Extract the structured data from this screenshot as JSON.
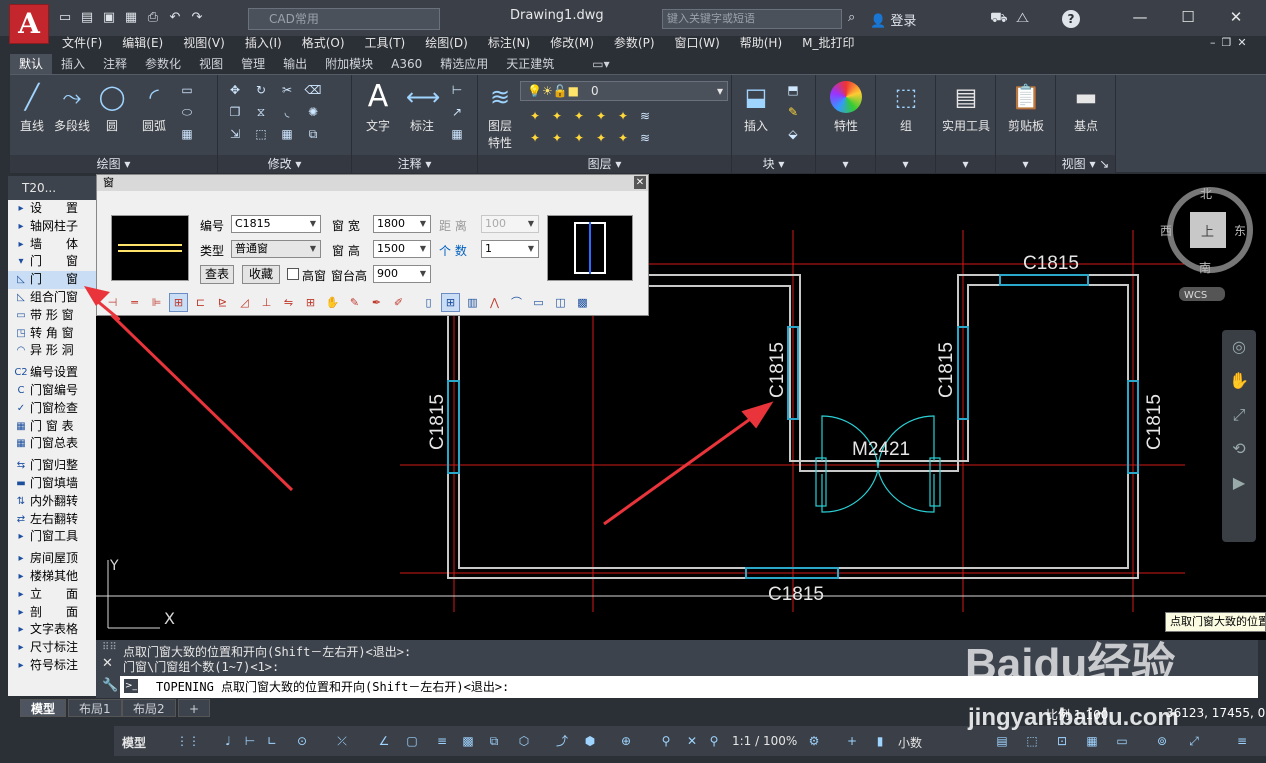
{
  "title_bar": {
    "app_letter": "A",
    "workspace": "CAD常用",
    "document_title": "Drawing1.dwg",
    "search_placeholder": "键入关键字或短语",
    "login_label": "登录"
  },
  "menubar": [
    "文件(F)",
    "编辑(E)",
    "视图(V)",
    "插入(I)",
    "格式(O)",
    "工具(T)",
    "绘图(D)",
    "标注(N)",
    "修改(M)",
    "参数(P)",
    "窗口(W)",
    "帮助(H)",
    "M_批打印"
  ],
  "ribbon_tabs": [
    "默认",
    "插入",
    "注释",
    "参数化",
    "视图",
    "管理",
    "输出",
    "附加模块",
    "A360",
    "精选应用",
    "天正建筑"
  ],
  "ribbon": {
    "draw": {
      "label": "绘图",
      "buttons": [
        "直线",
        "多段线",
        "圆",
        "圆弧"
      ]
    },
    "modify": {
      "label": "修改"
    },
    "annotation": {
      "label": "注释",
      "buttons": [
        "文字",
        "标注"
      ]
    },
    "layers": {
      "label": "图层",
      "button": "图层\n特性",
      "layer_name": "0"
    },
    "block": {
      "label": "块",
      "button": "插入"
    },
    "properties": {
      "button": "特性"
    },
    "group": {
      "button": "组"
    },
    "utilities": {
      "button": "实用工具"
    },
    "clipboard": {
      "button": "剪贴板"
    },
    "base": {
      "button": "基点"
    },
    "view": {
      "label": "视图"
    }
  },
  "palette": {
    "header": "T20...",
    "items": [
      "设　　置",
      "轴网柱子",
      "墙　　体",
      "门　　窗",
      "门　　窗",
      "组合门窗",
      "带 形 窗",
      "转 角 窗",
      "异 形 洞",
      "编号设置",
      "门窗编号",
      "门窗检查",
      "门 窗 表",
      "门窗总表",
      "门窗归整",
      "门窗填墙",
      "内外翻转",
      "左右翻转",
      "门窗工具",
      "房间屋顶",
      "楼梯其他",
      "立　　面",
      "剖　　面",
      "文字表格",
      "尺寸标注",
      "符号标注"
    ]
  },
  "dialog": {
    "title": "窗",
    "number_label": "编号",
    "number_value": "C1815",
    "type_label": "类型",
    "type_value": "普通窗",
    "width_label": "窗 宽",
    "width_value": "1800",
    "height_label": "窗 高",
    "height_value": "1500",
    "sill_label": "窗台高",
    "sill_value": "900",
    "distance_label": "距 离",
    "distance_value": "100",
    "count_label": "个 数",
    "count_value": "1",
    "lookup_button": "查表",
    "favorite_button": "收藏",
    "high_window_label": "高窗"
  },
  "drawing": {
    "labels": {
      "top_right": "C1815",
      "left": "C1815",
      "center_left": "C1815",
      "center_right": "C1815",
      "right": "C1815",
      "bottom": "C1815",
      "door": "M2421"
    },
    "viewcube": {
      "north": "北",
      "south": "南",
      "east": "东",
      "west": "西",
      "center": "上",
      "wcs": "WCS"
    },
    "ucs": {
      "x": "X",
      "y": "Y"
    }
  },
  "command": {
    "history": [
      "点取门窗大致的位置和开向(Shift－左右开)<退出>:",
      "门窗\\门窗组个数(1~7)<1>:"
    ],
    "current": "TOPENING 点取门窗大致的位置和开向(Shift－左右开)<退出>:"
  },
  "tooltip": "点取门窗大致的位置和开向",
  "layout_tabs": [
    "模型",
    "布局1",
    "布局2",
    "+"
  ],
  "status": {
    "model": "模型",
    "scale_readout": "比例 1:100",
    "coords": "36123, 17455, 0",
    "annotation_scale": "1:1 / 100%",
    "text_size": "小数"
  },
  "watermark": {
    "main": "Baidu经验",
    "url": "jingyan.baidu.com"
  },
  "colors": {
    "canvas": "#000000",
    "wall": "#c8c8c8",
    "window": "#2aa7c9",
    "axis": "#d01818",
    "door": "#2ad0d6",
    "arrow": "#e8343a"
  }
}
